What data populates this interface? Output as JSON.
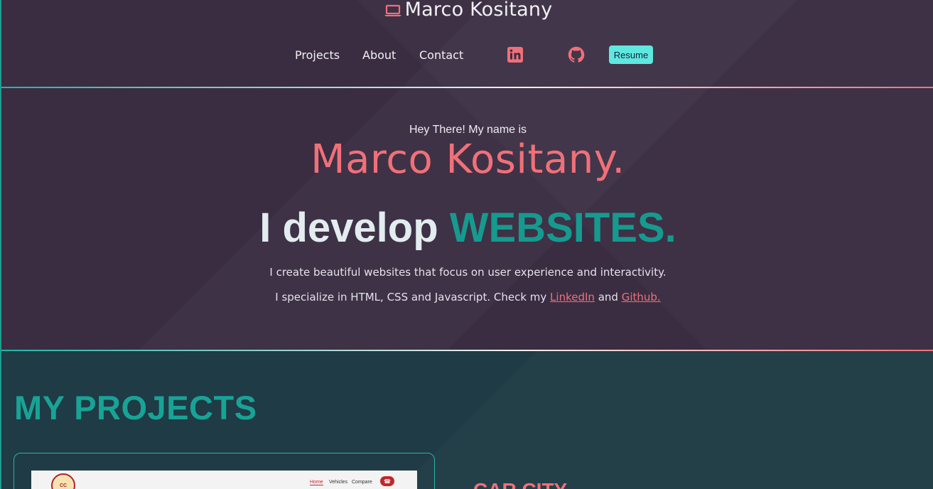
{
  "brand": {
    "name": "Marco Kositany",
    "icon": "laptop-icon"
  },
  "nav": {
    "items": [
      "Projects",
      "About",
      "Contact"
    ],
    "social": [
      {
        "icon": "linkedin-icon"
      },
      {
        "icon": "github-icon"
      }
    ],
    "resume_label": "Resume"
  },
  "hero": {
    "greeting": "Hey There! My name is",
    "name": "Marco Kositany.",
    "tagline_prefix": "I develop",
    "tagline_accent": "WEBSITES.",
    "line1": "I create beautiful websites that focus on user experience and interactivity.",
    "line2_prefix": "I specialize in HTML, CSS and Javascript. Check my",
    "line2_link1": "LinkedIn",
    "line2_mid": "and",
    "line2_link2": "Github."
  },
  "projects": {
    "title": "MY PROJECTS",
    "first_project_name": "CAR CITY",
    "thumbnail": {
      "nav": [
        "Home",
        "Vehicles",
        "Compare"
      ]
    }
  },
  "colors": {
    "accent_pink": "#f07079",
    "accent_teal": "#169a8f",
    "resume_button": "#5ee8df",
    "background_top": "#3a2d42",
    "background_projects": "#1f3b45"
  }
}
